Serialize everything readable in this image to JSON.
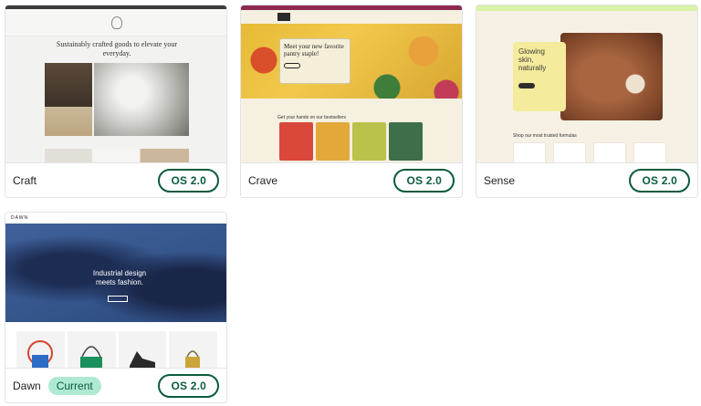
{
  "themes": [
    {
      "id": "craft",
      "name": "Craft",
      "badge": "OS 2.0",
      "preview": {
        "headline": "Sustainably crafted goods to elevate your everyday."
      }
    },
    {
      "id": "crave",
      "name": "Crave",
      "badge": "OS 2.0",
      "preview": {
        "headline": "Meet your new favorite pantry staple!",
        "subhead": "Get your hands on our bestsellers"
      }
    },
    {
      "id": "sense",
      "name": "Sense",
      "badge": "OS 2.0",
      "preview": {
        "headline": "Glowing skin, naturally",
        "subhead": "Shop our most trusted formulas"
      }
    },
    {
      "id": "dawn",
      "name": "Dawn",
      "badge": "OS 2.0",
      "current_label": "Current",
      "preview": {
        "logo": "DAWN",
        "headline": "Industrial design meets fashion."
      }
    }
  ],
  "colors": {
    "badge_border": "#0b5b3e",
    "current_bg": "#aee9d1"
  }
}
